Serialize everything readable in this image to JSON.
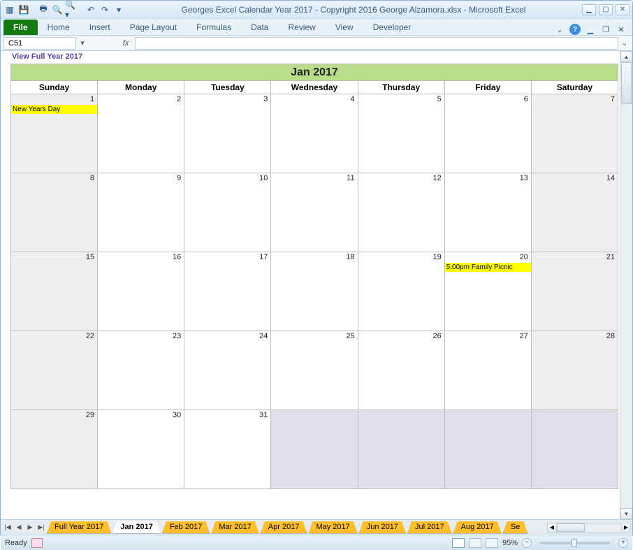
{
  "titlebar": {
    "title": "Georges Excel Calendar Year 2017 - Copyright 2016 George Alzamora.xlsx - Microsoft Excel"
  },
  "ribbon": {
    "file": "File",
    "tabs": [
      "Home",
      "Insert",
      "Page Layout",
      "Formulas",
      "Data",
      "Review",
      "View",
      "Developer"
    ]
  },
  "formula_bar": {
    "cell_ref": "C51",
    "fx": "fx",
    "formula": ""
  },
  "link_text": "View Full Year 2017",
  "calendar": {
    "title": "Jan 2017",
    "days": [
      "Sunday",
      "Monday",
      "Tuesday",
      "Wednesday",
      "Thursday",
      "Friday",
      "Saturday"
    ],
    "weeks": [
      [
        {
          "n": "1",
          "shaded": true,
          "event": "New Years Day"
        },
        {
          "n": "2"
        },
        {
          "n": "3"
        },
        {
          "n": "4"
        },
        {
          "n": "5"
        },
        {
          "n": "6"
        },
        {
          "n": "7",
          "shaded": true
        }
      ],
      [
        {
          "n": "8",
          "shaded": true
        },
        {
          "n": "9"
        },
        {
          "n": "10"
        },
        {
          "n": "11"
        },
        {
          "n": "12"
        },
        {
          "n": "13"
        },
        {
          "n": "14",
          "shaded": true
        }
      ],
      [
        {
          "n": "15",
          "shaded": true
        },
        {
          "n": "16"
        },
        {
          "n": "17"
        },
        {
          "n": "18"
        },
        {
          "n": "19"
        },
        {
          "n": "20",
          "event": "5:00pm Family Picnic"
        },
        {
          "n": "21",
          "shaded": true
        }
      ],
      [
        {
          "n": "22",
          "shaded": true
        },
        {
          "n": "23"
        },
        {
          "n": "24"
        },
        {
          "n": "25"
        },
        {
          "n": "26"
        },
        {
          "n": "27"
        },
        {
          "n": "28",
          "shaded": true
        }
      ],
      [
        {
          "n": "29",
          "shaded": true
        },
        {
          "n": "30"
        },
        {
          "n": "31"
        },
        {
          "n": "",
          "out": true
        },
        {
          "n": "",
          "out": true
        },
        {
          "n": "",
          "out": true
        },
        {
          "n": "",
          "out": true
        }
      ]
    ]
  },
  "sheet_tabs": [
    "Full Year 2017",
    "Jan 2017",
    "Feb 2017",
    "Mar 2017",
    "Apr 2017",
    "May 2017",
    "Jun 2017",
    "Jul 2017",
    "Aug 2017",
    "Se"
  ],
  "sheet_tabs_selected": 1,
  "statusbar": {
    "ready": "Ready",
    "zoom": "95%"
  }
}
